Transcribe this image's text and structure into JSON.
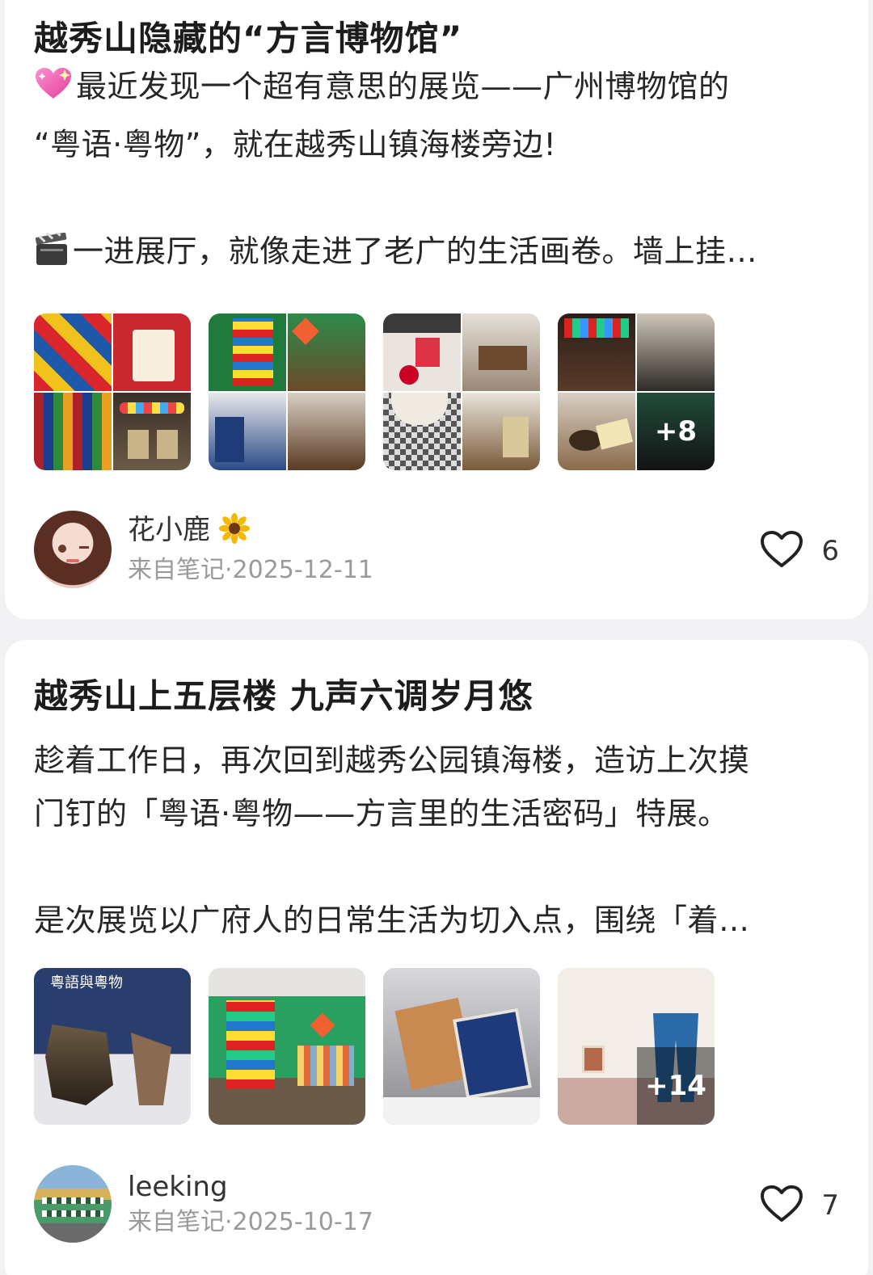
{
  "posts": [
    {
      "title": "越秀山隐藏的“方言博物馆”",
      "body_line1": "最近发现一个超有意思的展览——广州博物馆的",
      "body_line2": "“粤语·粤物”，就在越秀山镇海楼旁边!",
      "body_line3": "一进展厅，就像走进了老广的生活画卷。墙上挂…",
      "more_count": "+8",
      "author": "花小鹿",
      "meta": "来自笔记·2025-12-11",
      "likes": "6"
    },
    {
      "title": "越秀山上五层楼 九声六调岁月悠",
      "body_line1": "趁着工作日，再次回到越秀公园镇海楼，造访上次摸",
      "body_line2": "门钉的「粤语·粤物——方言里的生活密码」特展。",
      "body_line3": "是次展览以广府人的日常生活为切入点，围绕「着…",
      "img1_caption": "粵語與粵物",
      "img4_caption": "+14",
      "author": "leeking",
      "meta": "来自笔记·2025-10-17",
      "likes": "7"
    }
  ],
  "icons": {
    "sparkle_heart": "sparkling-heart-icon",
    "clapper": "clapper-board-icon",
    "sunflower": "sunflower-icon",
    "like": "heart-outline-icon"
  },
  "colors": {
    "background": "#f2f2f4",
    "card": "#ffffff",
    "meta_text": "#9a9a9a"
  }
}
